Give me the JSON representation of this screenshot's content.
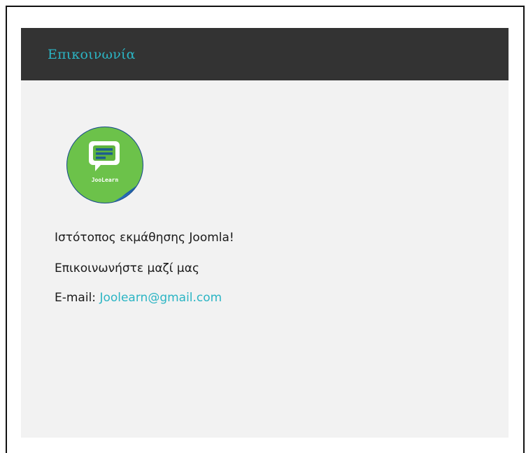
{
  "module": {
    "title": "Επικοινωνία"
  },
  "logo": {
    "text": "JooLearn",
    "icon": "chat-bubble-icon",
    "colors": {
      "green": "#6cc24a",
      "blue": "#1f5fa8",
      "ring": "#1d4f8c"
    }
  },
  "content": {
    "line1": "Ιστότοπος εκμάθησης Joomla!",
    "line2": "Επικοινωνήστε μαζί μας",
    "email_label": "E-mail: ",
    "email_value": "Joolearn@gmail.com"
  },
  "colors": {
    "header_bg": "#333333",
    "accent": "#2bb5c4",
    "panel_bg": "#f2f2f2"
  }
}
